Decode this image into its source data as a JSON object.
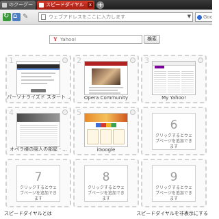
{
  "tabs": [
    {
      "label": "のクーグー",
      "active": false
    },
    {
      "label": "スピードダイヤル",
      "active": true
    }
  ],
  "tab_close_symbol": "x",
  "new_tab_symbol": "+",
  "address": {
    "placeholder": "ウェブアドレスをここに入力します"
  },
  "search_engine_field": {
    "placeholder": "Google"
  },
  "page_search": {
    "placeholder": "Yahoo!",
    "button": "検索"
  },
  "speed_dials": [
    {
      "number": "1",
      "label": "パーソナライズド スタート ...",
      "filled": true
    },
    {
      "number": "2",
      "label": "Opera Community",
      "filled": true
    },
    {
      "number": "3",
      "label": "My Yahoo!",
      "filled": true
    },
    {
      "number": "4",
      "label": "オペラ様の隠人の部屋 - ...",
      "filled": true
    },
    {
      "number": "5",
      "label": "iGoogle",
      "filled": true
    },
    {
      "number": "6",
      "label": "",
      "filled": false,
      "hint": "クリックするとウェブページを追加できます"
    },
    {
      "number": "7",
      "label": "",
      "filled": false,
      "hint": "クリックするとウェブページを追加できます"
    },
    {
      "number": "8",
      "label": "",
      "filled": false,
      "hint": "クリックするとウェブページを追加できます"
    },
    {
      "number": "9",
      "label": "",
      "filled": false,
      "hint": "クリックするとウェブページを追加できます"
    }
  ],
  "bottom_links": {
    "left": "スピードダイヤルとは",
    "right": "スピードダイヤルを非表示にする"
  },
  "colors": {
    "active_tab": "#c42a1c",
    "tab_bar": "#2a2a2a",
    "toolbar": "#e8e8e8"
  }
}
